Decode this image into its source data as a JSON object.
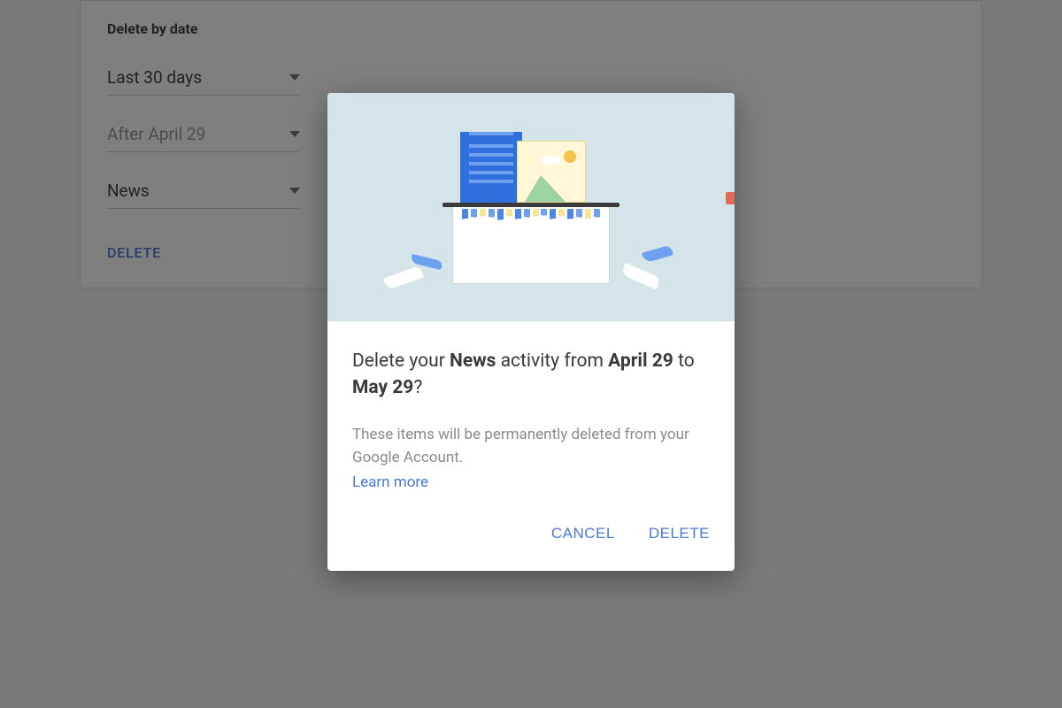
{
  "card": {
    "title": "Delete by date",
    "range": "Last 30 days",
    "after": "After April 29",
    "product": "News",
    "delete": "DELETE"
  },
  "dialog": {
    "q_prefix": "Delete your ",
    "q_product": "News",
    "q_mid": " activity from ",
    "q_from": "April 29",
    "q_to_word": " to ",
    "q_to": "May 29",
    "q_suffix": "?",
    "subtext": "These items will be permanently deleted from your Google Account.",
    "learn": "Learn more",
    "cancel": "CANCEL",
    "confirm": "DELETE"
  }
}
